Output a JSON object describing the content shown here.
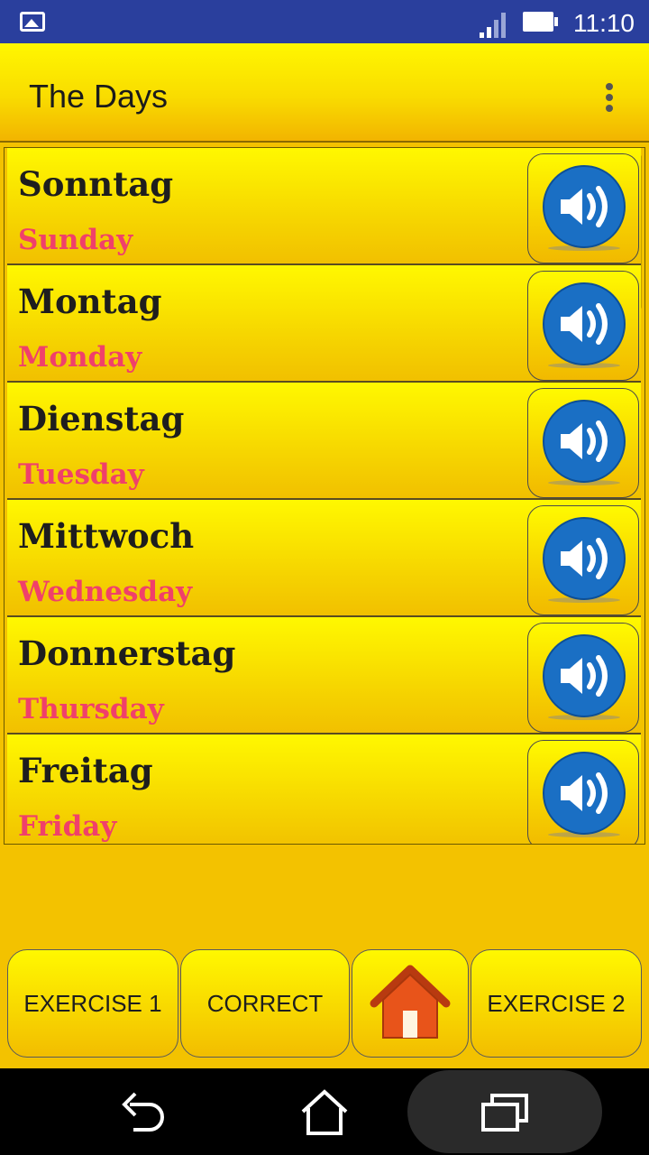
{
  "status_bar": {
    "time": "11:10",
    "icons": [
      "gallery-icon",
      "signal-icon",
      "battery-icon"
    ]
  },
  "app_bar": {
    "title": "The Days",
    "overflow_icon": "more-vert-icon"
  },
  "days": [
    {
      "german": "Sonntag",
      "english": "Sunday"
    },
    {
      "german": "Montag",
      "english": "Monday"
    },
    {
      "german": "Dienstag",
      "english": "Tuesday"
    },
    {
      "german": "Mittwoch",
      "english": "Wednesday"
    },
    {
      "german": "Donnerstag",
      "english": "Thursday"
    },
    {
      "german": "Freitag",
      "english": "Friday"
    }
  ],
  "bottom_buttons": {
    "exercise1": "EXERCISE 1",
    "correct": "CORRECT",
    "home_icon": "home-icon",
    "exercise2": "EXERCISE 2"
  },
  "nav_bar": {
    "icons": [
      "back-icon",
      "home-nav-icon",
      "recents-icon"
    ]
  },
  "colors": {
    "status_bar": "#2a3f9d",
    "german_text": "#1e1e1e",
    "english_text": "#f0406a",
    "speaker_blue": "#1a6fc4"
  }
}
